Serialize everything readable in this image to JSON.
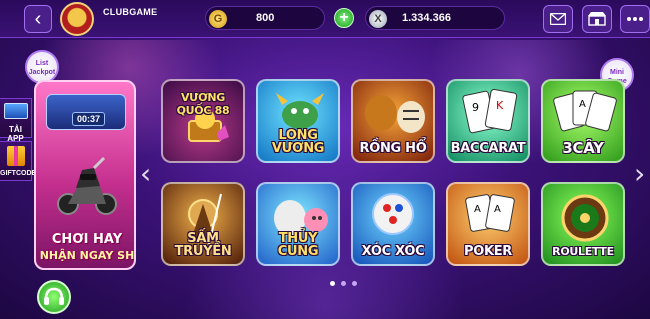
{
  "header": {
    "back_icon": "chevron-left-icon",
    "username": "CLUBGAME",
    "gold_balance": "800",
    "gold_coin_glyph": "G",
    "silver_balance": "1.334.366",
    "silver_coin_glyph": "X",
    "add_label": "+",
    "mail_icon": "mail-icon",
    "shop_icon": "shop-icon",
    "menu_icon": "more-icon"
  },
  "side": {
    "list_jackpot": "List Jackpot",
    "mini_game": "Mini Game",
    "tai_app": "TẢI APP",
    "giftcode": "GIFTCODE"
  },
  "promo": {
    "timer": "00:37",
    "line1": "CHƠI HAY",
    "line2": "NHẬN NGAY SH"
  },
  "games": [
    {
      "label": "VƯƠNG QUỐC 88"
    },
    {
      "label": "LONG VƯƠNG"
    },
    {
      "label": "RỒNG HỔ"
    },
    {
      "label": "BACCARAT"
    },
    {
      "label": "3CÂY"
    },
    {
      "label": "SẤM TRUYỀN"
    },
    {
      "label": "THỦY CUNG"
    },
    {
      "label": "XÓC XÓC"
    },
    {
      "label": "POKER"
    },
    {
      "label": "ROULETTE"
    }
  ],
  "nav": {
    "prev": "‹",
    "next": "›",
    "page_count": 3,
    "current_page": 1
  },
  "colors": {
    "background": "#3b1278",
    "accent": "#a06ef0",
    "gold": "#f2d27a"
  }
}
